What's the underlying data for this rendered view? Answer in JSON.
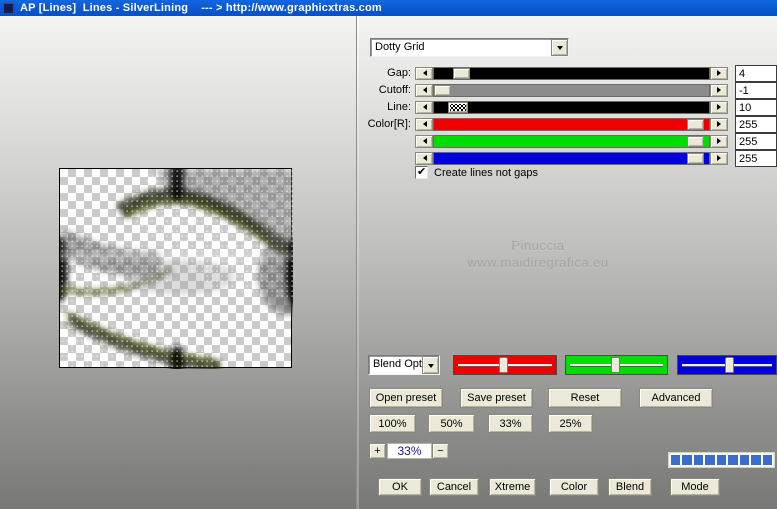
{
  "title_bar": {
    "title": "AP [Lines]  Lines - SilverLining    --- > http://www.graphicxtras.com"
  },
  "preset_dropdown": {
    "value": "Dotty Grid"
  },
  "sliders": [
    {
      "label": "Gap:",
      "value": "4"
    },
    {
      "label": "Cutoff:",
      "value": "-1"
    },
    {
      "label": "Line:",
      "value": "10"
    },
    {
      "label": "Color[R]:",
      "value": "255"
    },
    {
      "label": "",
      "value": "255"
    },
    {
      "label": "",
      "value": "255"
    }
  ],
  "slider_colors": {
    "gap": "#000000",
    "cutoff": "#8c8c8c",
    "line": "#000000",
    "red": "#ee0000",
    "green": "#00dd00",
    "blue": "#0000dd"
  },
  "checkbox": {
    "label": "Create lines not gaps",
    "checked": true
  },
  "watermark": {
    "line1": "Pinuccia",
    "line2": "www.maidiregrafica.eu"
  },
  "blend_dropdown": {
    "value": "Blend Opti"
  },
  "preset_buttons": {
    "open": "Open preset",
    "save": "Save preset",
    "reset": "Reset",
    "advanced": "Advanced"
  },
  "zoom_buttons": {
    "b100": "100%",
    "b50": "50%",
    "b33": "33%",
    "b25": "25%"
  },
  "zoom_control": {
    "plus": "+",
    "value": "33%",
    "minus": "−"
  },
  "progress": {
    "segments": 9,
    "color": "#3a6cd0"
  },
  "action_buttons": {
    "ok": "OK",
    "cancel": "Cancel",
    "xtreme": "Xtreme",
    "color": "Color",
    "blend": "Blend",
    "mode": "Mode"
  }
}
